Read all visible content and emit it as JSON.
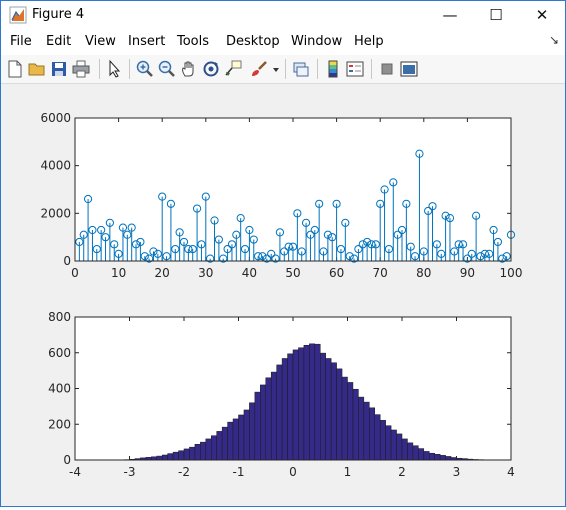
{
  "window": {
    "title": "Figure 4",
    "minimize_label": "—",
    "maximize_label": "☐",
    "close_label": "✕"
  },
  "menu": {
    "items": [
      "File",
      "Edit",
      "View",
      "Insert",
      "Tools",
      "Desktop",
      "Window",
      "Help"
    ],
    "overflow": "↘"
  },
  "toolbar": {
    "icons": [
      "new-figure-icon",
      "open-file-icon",
      "save-icon",
      "print-icon",
      "pointer-icon",
      "zoom-in-icon",
      "zoom-out-icon",
      "pan-icon",
      "rotate-3d-icon",
      "data-cursor-icon",
      "brush-icon",
      "brush-dropdown-icon",
      "link-plot-icon",
      "colorbar-icon",
      "legend-icon",
      "hide-plot-tools-icon",
      "show-plot-tools-icon"
    ]
  },
  "chart_data": [
    {
      "type": "stem",
      "xlim": [
        0,
        100
      ],
      "ylim": [
        0,
        6000
      ],
      "xticks": [
        0,
        10,
        20,
        30,
        40,
        50,
        60,
        70,
        80,
        90,
        100
      ],
      "yticks": [
        0,
        2000,
        4000,
        6000
      ],
      "x": [
        1,
        2,
        3,
        4,
        5,
        6,
        7,
        8,
        9,
        10,
        11,
        12,
        13,
        14,
        15,
        16,
        17,
        18,
        19,
        20,
        21,
        22,
        23,
        24,
        25,
        26,
        27,
        28,
        29,
        30,
        31,
        32,
        33,
        34,
        35,
        36,
        37,
        38,
        39,
        40,
        41,
        42,
        43,
        44,
        45,
        46,
        47,
        48,
        49,
        50,
        51,
        52,
        53,
        54,
        55,
        56,
        57,
        58,
        59,
        60,
        61,
        62,
        63,
        64,
        65,
        66,
        67,
        68,
        69,
        70,
        71,
        72,
        73,
        74,
        75,
        76,
        77,
        78,
        79,
        80,
        81,
        82,
        83,
        84,
        85,
        86,
        87,
        88,
        89,
        90,
        91,
        92,
        93,
        94,
        95,
        96,
        97,
        98,
        99,
        100
      ],
      "values": [
        800,
        1100,
        2600,
        1300,
        500,
        1300,
        1000,
        1600,
        700,
        300,
        1400,
        1100,
        1400,
        700,
        800,
        200,
        100,
        400,
        300,
        2700,
        200,
        2400,
        500,
        1200,
        800,
        500,
        500,
        2200,
        700,
        2700,
        100,
        1700,
        900,
        100,
        500,
        700,
        1100,
        1800,
        500,
        1300,
        900,
        200,
        200,
        100,
        300,
        100,
        1200,
        400,
        600,
        600,
        2000,
        400,
        1600,
        1100,
        1300,
        2400,
        400,
        1100,
        1000,
        2400,
        500,
        1600,
        200,
        100,
        500,
        700,
        800,
        700,
        700,
        2400,
        3000,
        500,
        3300,
        1100,
        1300,
        2400,
        600,
        200,
        4500,
        400,
        2100,
        2300,
        700,
        300,
        1900,
        1800,
        400,
        700,
        700,
        100,
        300,
        1900,
        200,
        300,
        300,
        1300,
        800,
        100,
        200,
        1100
      ]
    },
    {
      "type": "bar",
      "xlim": [
        -4,
        4
      ],
      "ylim": [
        0,
        800
      ],
      "xticks": [
        -4,
        -3,
        -2,
        -1,
        0,
        1,
        2,
        3,
        4
      ],
      "yticks": [
        0,
        200,
        400,
        600,
        800
      ],
      "bin_width": 0.1,
      "bin_start": -3.1,
      "values": [
        2,
        4,
        8,
        12,
        15,
        18,
        22,
        28,
        36,
        44,
        52,
        62,
        72,
        88,
        100,
        118,
        136,
        160,
        184,
        212,
        230,
        252,
        280,
        320,
        380,
        420,
        460,
        492,
        532,
        568,
        594,
        616,
        628,
        642,
        650,
        648,
        598,
        568,
        544,
        510,
        464,
        434,
        396,
        352,
        324,
        292,
        254,
        222,
        192,
        168,
        146,
        118,
        96,
        80,
        64,
        48,
        38,
        32,
        26,
        20,
        14,
        10,
        8,
        5,
        3,
        2
      ]
    }
  ]
}
